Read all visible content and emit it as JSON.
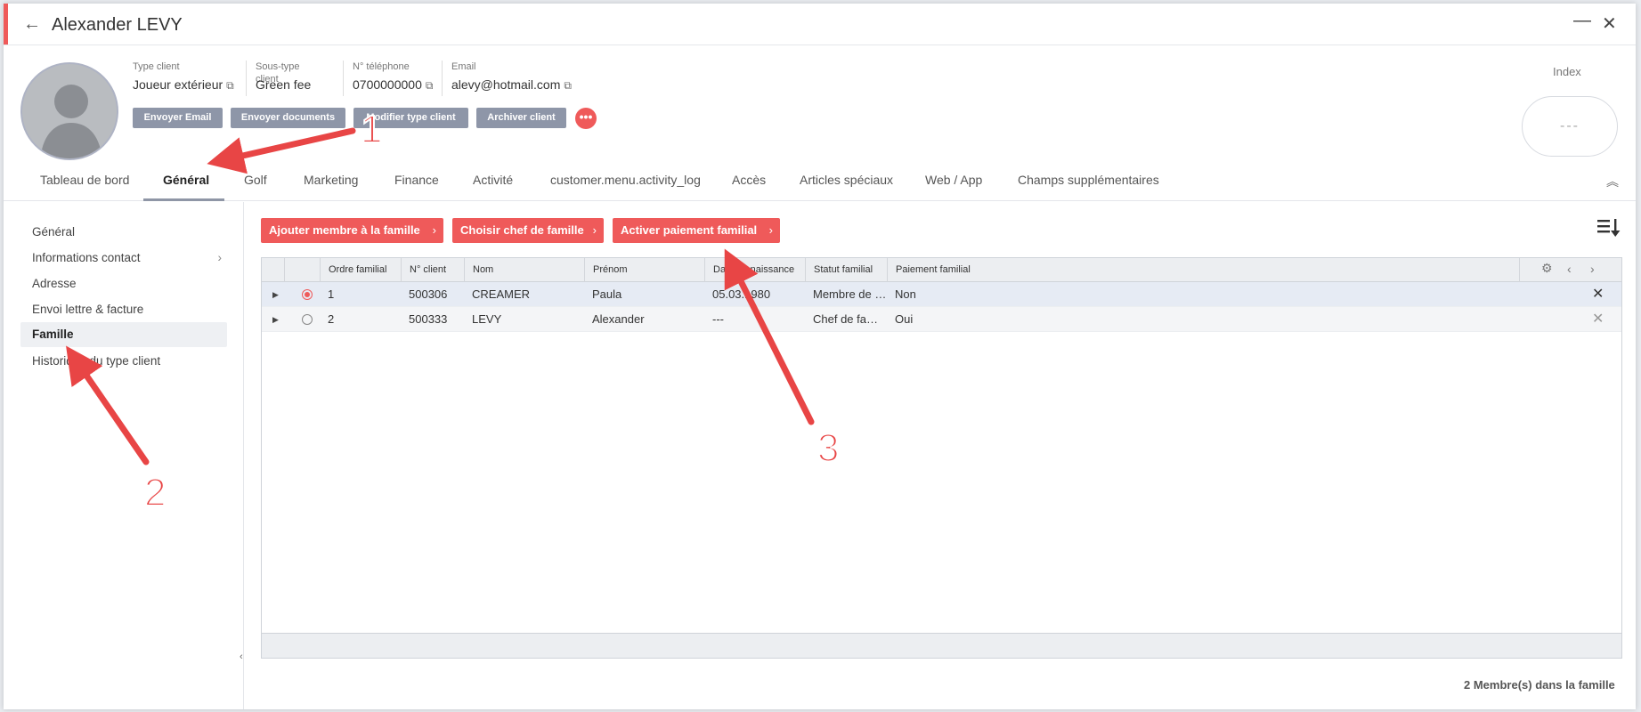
{
  "header": {
    "title": "Alexander LEVY",
    "back_icon": "arrow-left-icon",
    "minimize_icon": "minimize-icon",
    "close_icon": "close-icon"
  },
  "fields": [
    {
      "label": "Type client",
      "value": "Joueur extérieur",
      "link": true
    },
    {
      "label": "Sous-type client",
      "value": "Green fee",
      "link": false
    },
    {
      "label": "N° téléphone",
      "value": "0700000000",
      "link": true
    },
    {
      "label": "Email",
      "value": "alevy@hotmail.com",
      "link": true
    }
  ],
  "actions": [
    "Envoyer Email",
    "Envoyer documents",
    "Modifier type client",
    "Archiver client"
  ],
  "more_label": "•••",
  "index": {
    "label": "Index",
    "value": "---"
  },
  "tabs": [
    "Tableau de bord",
    "Général",
    "Golf",
    "Marketing",
    "Finance",
    "Activité",
    "customer.menu.activity_log",
    "Accès",
    "Articles spéciaux",
    "Web / App",
    "Champs supplémentaires"
  ],
  "active_tab": "Général",
  "sidenav": [
    "Général",
    "Informations contact",
    "Adresse",
    "Envoi lettre & facture",
    "Famille",
    "Historique du type client"
  ],
  "active_sidenav": "Famille",
  "family_buttons": [
    "Ajouter membre à la famille",
    "Choisir chef de famille",
    "Activer paiement familial"
  ],
  "grid": {
    "columns": [
      "Ordre familial",
      "N° client",
      "Nom",
      "Prénom",
      "Date de naissance",
      "Statut familial",
      "Paiement familial"
    ],
    "rows": [
      {
        "selected": true,
        "order": "1",
        "client": "500306",
        "nom": "CREAMER",
        "prenom": "Paula",
        "naissance": "05.03.1980",
        "statut": "Membre de famille",
        "paiement": "Non"
      },
      {
        "selected": false,
        "order": "2",
        "client": "500333",
        "nom": "LEVY",
        "prenom": "Alexander",
        "naissance": "---",
        "statut": "Chef de famille",
        "paiement": "Oui"
      }
    ]
  },
  "member_count": "2 Membre(s) dans la famille",
  "annotations": [
    "1",
    "2",
    "3"
  ],
  "colors": {
    "accent": "#ef5a5a",
    "gray_button": "#8e96a8"
  }
}
